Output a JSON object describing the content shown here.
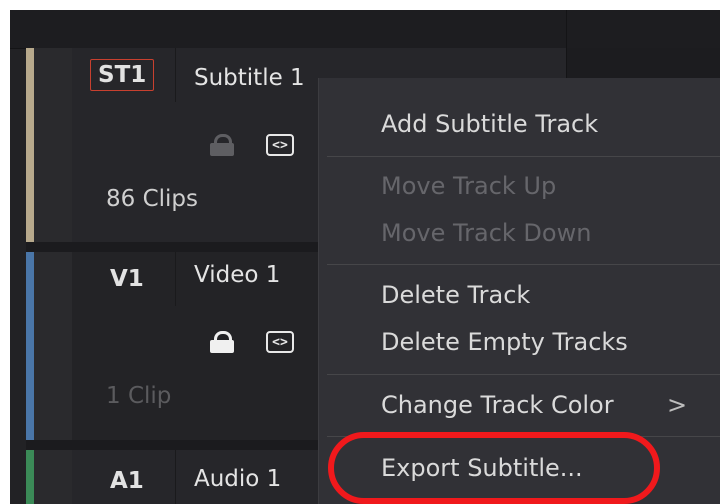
{
  "tracks": [
    {
      "id": "ST1",
      "name": "Subtitle 1",
      "clips": "86 Clips",
      "color": "#b7a98c"
    },
    {
      "id": "V1",
      "name": "Video 1",
      "clips": "1 Clip",
      "color": "#4a76a8"
    },
    {
      "id": "A1",
      "name": "Audio 1",
      "color": "#3b8a57"
    }
  ],
  "code_icon": "<>",
  "context_menu": {
    "add_subtitle_track": "Add Subtitle Track",
    "move_track_up": "Move Track Up",
    "move_track_down": "Move Track Down",
    "delete_track": "Delete Track",
    "delete_empty_tracks": "Delete Empty Tracks",
    "change_track_color": "Change Track Color",
    "submenu_arrow": ">",
    "export_subtitle": "Export Subtitle..."
  },
  "colors": {
    "highlight_ring": "#f0191c",
    "track_id_border": "#c8402f"
  }
}
